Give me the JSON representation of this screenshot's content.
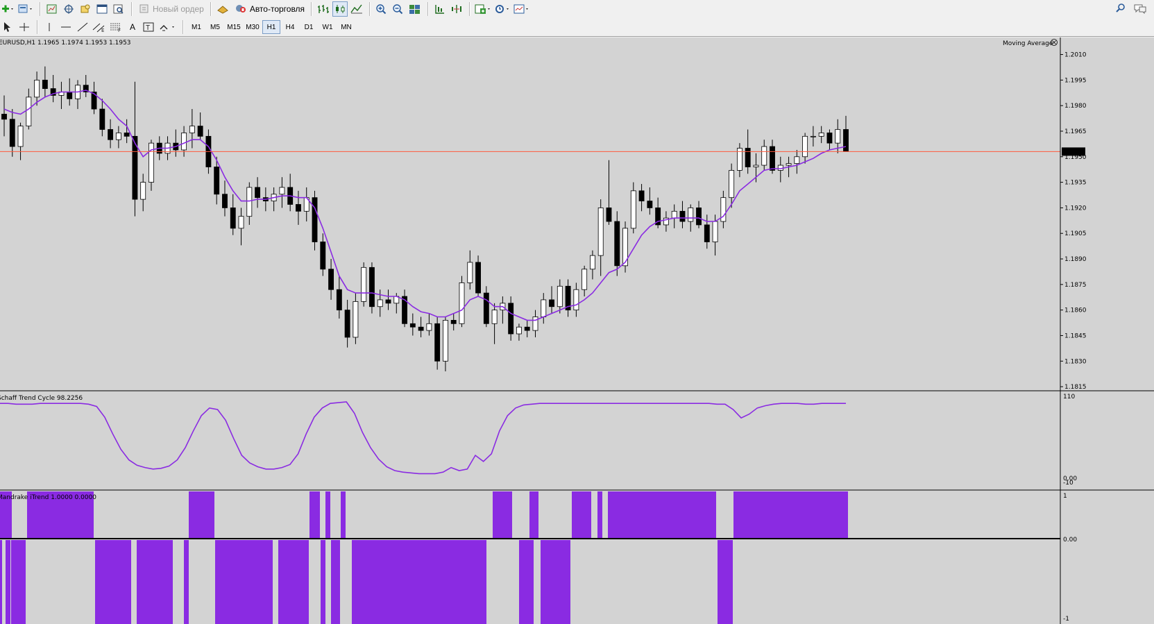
{
  "toolbar_main": {
    "new_order_label": "Новый ордер",
    "auto_trading_label": "Авто-торговля",
    "icons": [
      "new-chart-icon",
      "profiles-icon",
      "market-watch-icon",
      "navigator-icon",
      "data-window-icon",
      "terminal-icon",
      "tester-icon",
      "new-order-icon",
      "auto-trading-icon",
      "bar-chart-icon",
      "candle-chart-icon",
      "line-chart-icon",
      "zoom-in-icon",
      "zoom-out-icon",
      "tile-windows-icon",
      "auto-scroll-icon",
      "chart-shift-icon",
      "indicators-icon",
      "periods-icon",
      "templates-icon",
      "search-icon",
      "chat-icon"
    ]
  },
  "toolbar_draw": {
    "timeframes": [
      "M1",
      "M5",
      "M15",
      "M30",
      "H1",
      "H4",
      "D1",
      "W1",
      "MN"
    ],
    "active_timeframe": "H1",
    "text_tool_label": "A"
  },
  "chart": {
    "symbol_info": "EURUSD,H1  1.1965 1.1974 1.1953 1.1953",
    "price_labels": [
      "1.2010",
      "1.1995",
      "1.1980",
      "1.1965",
      "1.1950",
      "1.1935",
      "1.1920",
      "1.1905",
      "1.1890",
      "1.1875",
      "1.1860",
      "1.1845",
      "1.1830",
      "1.1815"
    ],
    "current_price": "1.1953",
    "indicator_label": "Moving Average",
    "colors": {
      "background": "#d3d3d3",
      "ma_line": "#8a2be2",
      "bid_line": "#ff5a3c",
      "candle_bull": "#ffffff",
      "candle_bear": "#000000",
      "histogram": "#8a2be2"
    }
  },
  "chart_data": [
    {
      "type": "candlestick",
      "title": "EURUSD,H1",
      "ylim": [
        1.1813,
        1.202
      ],
      "current": 1.1953,
      "candles": [
        [
          1.1975,
          1.1986,
          1.1962,
          1.1972
        ],
        [
          1.1972,
          1.1978,
          1.195,
          1.1956
        ],
        [
          1.1956,
          1.197,
          1.1948,
          1.1968
        ],
        [
          1.1968,
          1.199,
          1.1966,
          1.1985
        ],
        [
          1.1985,
          1.2,
          1.198,
          1.1995
        ],
        [
          1.1995,
          1.2003,
          1.1985,
          1.199
        ],
        [
          1.199,
          1.1998,
          1.1982,
          1.1986
        ],
        [
          1.1986,
          1.1994,
          1.1978,
          1.1988
        ],
        [
          1.1988,
          1.1996,
          1.198,
          1.1984
        ],
        [
          1.1984,
          1.1995,
          1.1978,
          1.1992
        ],
        [
          1.1992,
          1.1998,
          1.1985,
          1.1988
        ],
        [
          1.1988,
          1.1994,
          1.1975,
          1.1978
        ],
        [
          1.1978,
          1.1984,
          1.1962,
          1.1966
        ],
        [
          1.1966,
          1.1972,
          1.1955,
          1.196
        ],
        [
          1.196,
          1.1968,
          1.1955,
          1.1964
        ],
        [
          1.1964,
          1.1972,
          1.1958,
          1.1962
        ],
        [
          1.1962,
          1.1994,
          1.1915,
          1.1925
        ],
        [
          1.1925,
          1.194,
          1.1918,
          1.1935
        ],
        [
          1.1935,
          1.196,
          1.193,
          1.1958
        ],
        [
          1.1958,
          1.1962,
          1.1948,
          1.1952
        ],
        [
          1.1952,
          1.1962,
          1.1948,
          1.1958
        ],
        [
          1.1958,
          1.1966,
          1.195,
          1.1954
        ],
        [
          1.1954,
          1.1968,
          1.195,
          1.1964
        ],
        [
          1.1964,
          1.1978,
          1.1955,
          1.1968
        ],
        [
          1.1968,
          1.1976,
          1.196,
          1.1962
        ],
        [
          1.1962,
          1.1966,
          1.194,
          1.1944
        ],
        [
          1.1944,
          1.195,
          1.1922,
          1.1928
        ],
        [
          1.1928,
          1.1936,
          1.1915,
          1.192
        ],
        [
          1.192,
          1.1928,
          1.1904,
          1.1908
        ],
        [
          1.1908,
          1.192,
          1.1898,
          1.1915
        ],
        [
          1.1915,
          1.1935,
          1.191,
          1.1932
        ],
        [
          1.1932,
          1.1938,
          1.192,
          1.1926
        ],
        [
          1.1926,
          1.1932,
          1.1918,
          1.1924
        ],
        [
          1.1924,
          1.1932,
          1.1918,
          1.1928
        ],
        [
          1.1928,
          1.1938,
          1.192,
          1.1932
        ],
        [
          1.1932,
          1.194,
          1.1918,
          1.1922
        ],
        [
          1.1922,
          1.193,
          1.191,
          1.1918
        ],
        [
          1.1918,
          1.1932,
          1.1912,
          1.1926
        ],
        [
          1.1926,
          1.193,
          1.1895,
          1.19
        ],
        [
          1.19,
          1.1905,
          1.188,
          1.1884
        ],
        [
          1.1884,
          1.189,
          1.1866,
          1.1872
        ],
        [
          1.1872,
          1.188,
          1.1855,
          1.186
        ],
        [
          1.186,
          1.1866,
          1.1838,
          1.1844
        ],
        [
          1.1844,
          1.187,
          1.184,
          1.1865
        ],
        [
          1.1865,
          1.1888,
          1.1862,
          1.1885
        ],
        [
          1.1885,
          1.1888,
          1.1858,
          1.1862
        ],
        [
          1.1862,
          1.1872,
          1.1856,
          1.1866
        ],
        [
          1.1866,
          1.1872,
          1.186,
          1.1864
        ],
        [
          1.1864,
          1.187,
          1.1858,
          1.1868
        ],
        [
          1.1868,
          1.1872,
          1.185,
          1.1852
        ],
        [
          1.1852,
          1.1858,
          1.1845,
          1.185
        ],
        [
          1.185,
          1.1856,
          1.1844,
          1.1848
        ],
        [
          1.1848,
          1.1858,
          1.1845,
          1.1852
        ],
        [
          1.1852,
          1.1856,
          1.1825,
          1.183
        ],
        [
          1.183,
          1.1856,
          1.1824,
          1.1854
        ],
        [
          1.1854,
          1.1858,
          1.1848,
          1.1852
        ],
        [
          1.1852,
          1.188,
          1.185,
          1.1876
        ],
        [
          1.1876,
          1.1895,
          1.1872,
          1.1888
        ],
        [
          1.1888,
          1.1892,
          1.1868,
          1.187
        ],
        [
          1.187,
          1.1874,
          1.185,
          1.1852
        ],
        [
          1.1852,
          1.1864,
          1.184,
          1.186
        ],
        [
          1.186,
          1.1868,
          1.1852,
          1.1864
        ],
        [
          1.1864,
          1.1868,
          1.1842,
          1.1846
        ],
        [
          1.1846,
          1.1852,
          1.1842,
          1.185
        ],
        [
          1.185,
          1.1854,
          1.1844,
          1.1848
        ],
        [
          1.1848,
          1.186,
          1.1844,
          1.1856
        ],
        [
          1.1856,
          1.187,
          1.1852,
          1.1866
        ],
        [
          1.1866,
          1.1874,
          1.1858,
          1.1862
        ],
        [
          1.1862,
          1.1878,
          1.1858,
          1.1874
        ],
        [
          1.1874,
          1.1878,
          1.1856,
          1.186
        ],
        [
          1.186,
          1.1876,
          1.1856,
          1.1872
        ],
        [
          1.1872,
          1.1886,
          1.1868,
          1.1884
        ],
        [
          1.1884,
          1.1895,
          1.1878,
          1.1892
        ],
        [
          1.1892,
          1.1925,
          1.188,
          1.192
        ],
        [
          1.192,
          1.1948,
          1.191,
          1.1912
        ],
        [
          1.1912,
          1.1918,
          1.188,
          1.1886
        ],
        [
          1.1886,
          1.1912,
          1.1882,
          1.1908
        ],
        [
          1.1908,
          1.1935,
          1.1905,
          1.193
        ],
        [
          1.193,
          1.1934,
          1.1918,
          1.1924
        ],
        [
          1.1924,
          1.1932,
          1.1916,
          1.192
        ],
        [
          1.192,
          1.1926,
          1.1908,
          1.191
        ],
        [
          1.191,
          1.1918,
          1.1906,
          1.1914
        ],
        [
          1.1914,
          1.1922,
          1.1908,
          1.1918
        ],
        [
          1.1918,
          1.1924,
          1.1908,
          1.1912
        ],
        [
          1.1912,
          1.1922,
          1.1906,
          1.192
        ],
        [
          1.192,
          1.1924,
          1.1908,
          1.191
        ],
        [
          1.191,
          1.1916,
          1.1896,
          1.19
        ],
        [
          1.19,
          1.1916,
          1.1892,
          1.1912
        ],
        [
          1.1912,
          1.193,
          1.1908,
          1.1926
        ],
        [
          1.1926,
          1.1946,
          1.192,
          1.1942
        ],
        [
          1.1942,
          1.1958,
          1.1938,
          1.1955
        ],
        [
          1.1955,
          1.1966,
          1.194,
          1.1944
        ],
        [
          1.1944,
          1.1952,
          1.1935,
          1.1945
        ],
        [
          1.1945,
          1.196,
          1.1942,
          1.1956
        ],
        [
          1.1956,
          1.196,
          1.194,
          1.1942
        ],
        [
          1.1942,
          1.195,
          1.1935,
          1.1945
        ],
        [
          1.1945,
          1.195,
          1.1938,
          1.1946
        ],
        [
          1.1946,
          1.1954,
          1.194,
          1.195
        ],
        [
          1.195,
          1.1964,
          1.1946,
          1.1962
        ],
        [
          1.1962,
          1.1968,
          1.1956,
          1.1962
        ],
        [
          1.1962,
          1.1968,
          1.1958,
          1.1964
        ],
        [
          1.1964,
          1.1966,
          1.1954,
          1.1958
        ],
        [
          1.1958,
          1.1972,
          1.1952,
          1.1966
        ],
        [
          1.1966,
          1.1974,
          1.1953,
          1.1953
        ]
      ],
      "moving_average": [
        1.1978,
        1.1976,
        1.1975,
        1.1978,
        1.1982,
        1.1985,
        1.1987,
        1.1988,
        1.1988,
        1.1988,
        1.1989,
        1.1987,
        1.1983,
        1.1978,
        1.1972,
        1.1968,
        1.1958,
        1.195,
        1.1954,
        1.1955,
        1.1955,
        1.1956,
        1.1958,
        1.196,
        1.196,
        1.1956,
        1.1948,
        1.1938,
        1.193,
        1.1924,
        1.1924,
        1.1925,
        1.1925,
        1.1926,
        1.1927,
        1.1927,
        1.1926,
        1.1926,
        1.192,
        1.1908,
        1.1894,
        1.188,
        1.1872,
        1.187,
        1.187,
        1.187,
        1.1869,
        1.1868,
        1.1868,
        1.1866,
        1.1862,
        1.1859,
        1.1858,
        1.1856,
        1.1856,
        1.1858,
        1.186,
        1.1866,
        1.1868,
        1.1866,
        1.1862,
        1.1862,
        1.1858,
        1.1856,
        1.1854,
        1.1854,
        1.1856,
        1.1858,
        1.186,
        1.1862,
        1.1863,
        1.1866,
        1.187,
        1.1876,
        1.1882,
        1.1884,
        1.1888,
        1.1896,
        1.1904,
        1.1909,
        1.1912,
        1.1913,
        1.1914,
        1.1914,
        1.1914,
        1.1914,
        1.1912,
        1.1912,
        1.1915,
        1.1922,
        1.193,
        1.1934,
        1.1938,
        1.1942,
        1.1943,
        1.1943,
        1.1944,
        1.1945,
        1.1947,
        1.1949,
        1.1952,
        1.1954,
        1.1955,
        1.1956
      ]
    },
    {
      "type": "line",
      "title": "Schaff Trend Cycle 98.2256",
      "ylim": [
        -10,
        110
      ],
      "y_labels": [
        "110",
        "0.00",
        "-10"
      ],
      "values": [
        98,
        98,
        97,
        97,
        97,
        98,
        98,
        98,
        98,
        98,
        98,
        97,
        94,
        80,
        58,
        38,
        24,
        17,
        14,
        12,
        13,
        16,
        24,
        40,
        62,
        82,
        92,
        90,
        76,
        52,
        30,
        20,
        15,
        12,
        12,
        14,
        18,
        32,
        58,
        80,
        92,
        98,
        99,
        100,
        85,
        60,
        40,
        25,
        15,
        10,
        8,
        7,
        6,
        6,
        6,
        8,
        14,
        10,
        12,
        30,
        22,
        32,
        62,
        82,
        92,
        96,
        97,
        98,
        98,
        98,
        98,
        98,
        98,
        98,
        98,
        98,
        98,
        98,
        98,
        98,
        98,
        98,
        98,
        98,
        98,
        98,
        98,
        98,
        98,
        97,
        97,
        90,
        79,
        84,
        92,
        95,
        97,
        98,
        98,
        98,
        97,
        97,
        98,
        98,
        98,
        98
      ]
    },
    {
      "type": "histogram",
      "title": "Mandrake iTrend 1.0000 0.0000",
      "ylim": [
        -1,
        1
      ],
      "y_labels": [
        "1",
        "0.00",
        "-1"
      ],
      "upper_blocks": [
        [
          0,
          17
        ],
        [
          39,
          135
        ],
        [
          272,
          309
        ],
        [
          446,
          461
        ],
        [
          469,
          476
        ],
        [
          491,
          498
        ],
        [
          710,
          738
        ],
        [
          763,
          776
        ],
        [
          824,
          852
        ],
        [
          861,
          868
        ],
        [
          876,
          1032
        ],
        [
          1057,
          1222
        ]
      ],
      "lower_blocks": [
        [
          0,
          3
        ],
        [
          8,
          15
        ],
        [
          16,
          37
        ],
        [
          137,
          189
        ],
        [
          197,
          249
        ],
        [
          265,
          272
        ],
        [
          310,
          393
        ],
        [
          401,
          445
        ],
        [
          462,
          469
        ],
        [
          477,
          490
        ],
        [
          507,
          701
        ],
        [
          748,
          769
        ],
        [
          779,
          822
        ],
        [
          1034,
          1056
        ]
      ]
    }
  ]
}
